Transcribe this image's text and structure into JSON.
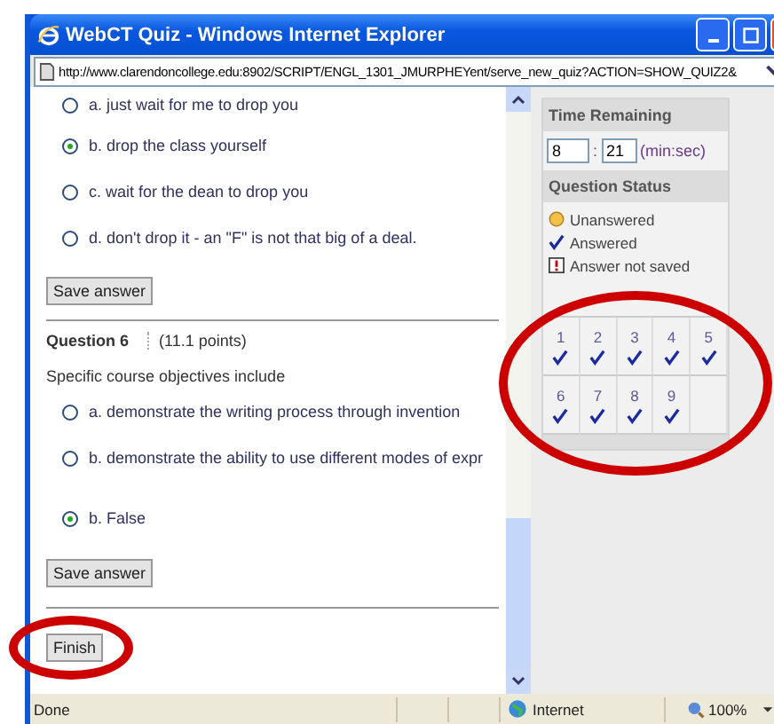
{
  "window": {
    "title": "WebCT Quiz - Windows Internet Explorer",
    "address": "http://www.clarendoncollege.edu:8902/SCRIPT/ENGL_1301_JMURPHEYent/serve_new_quiz?ACTION=SHOW_QUIZ2&"
  },
  "previous_question": {
    "options": [
      {
        "label": "a. just wait for me to drop you",
        "selected": false
      },
      {
        "label": "b. drop the class yourself",
        "selected": true
      },
      {
        "label": "c. wait for the dean to drop you",
        "selected": false
      },
      {
        "label": "d. don't drop it - an \"F\" is not that big of a deal.",
        "selected": false
      }
    ],
    "save_button": "Save answer"
  },
  "question": {
    "title": "Question 6",
    "points": "(11.1 points)",
    "prompt": "Specific course objectives include",
    "options": [
      {
        "label": "a. demonstrate the writing process through invention",
        "selected": false
      },
      {
        "label": "b. demonstrate the ability to use different modes of expr",
        "selected": false
      },
      {
        "label": "b. False",
        "selected": true
      }
    ],
    "save_button": "Save answer"
  },
  "finish_button": "Finish",
  "time_remaining": {
    "title": "Time Remaining",
    "minutes": "8",
    "separator": ":",
    "seconds": "21",
    "unit": "(min:sec)"
  },
  "question_status": {
    "title": "Question Status",
    "legend": [
      {
        "kind": "unanswered",
        "label": "Unanswered"
      },
      {
        "kind": "answered",
        "label": "Answered"
      },
      {
        "kind": "not_saved",
        "label": "Answer not saved"
      }
    ],
    "questions": [
      {
        "number": "1",
        "answered": true
      },
      {
        "number": "2",
        "answered": true
      },
      {
        "number": "3",
        "answered": true
      },
      {
        "number": "4",
        "answered": true
      },
      {
        "number": "5",
        "answered": true
      },
      {
        "number": "6",
        "answered": true
      },
      {
        "number": "7",
        "answered": true
      },
      {
        "number": "8",
        "answered": true
      },
      {
        "number": "9",
        "answered": true
      }
    ]
  },
  "status_bar": {
    "text": "Done",
    "zone": "Internet",
    "zoom": "100%"
  }
}
